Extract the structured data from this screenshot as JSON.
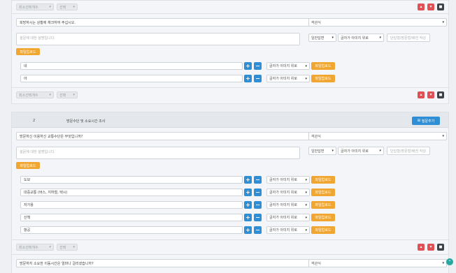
{
  "q1": {
    "top_controls": {
      "min_select": "최소선택개수",
      "max_select": "선택"
    },
    "question_text": "희망하시는 상황에 체크하여 주십시오.",
    "type_select": "객관식",
    "desc_placeholder": "설문에 대한 설명입니다.",
    "answer_type": "일반답변",
    "char_type": "글자가 아미지 위로",
    "unit_placeholder": "단답형/장문형/배전 작성",
    "file_upload": "파일업로드",
    "options": [
      {
        "value": "네",
        "char_type": "글자가 아미지 위로",
        "upload": "파일업로드"
      },
      {
        "value": "아",
        "char_type": "글자가 아미지 위로",
        "upload": "파일업로드"
      }
    ],
    "bottom_controls": {
      "min_select": "최소선택개수",
      "max_select": "선택"
    }
  },
  "section2": {
    "number": "2",
    "title": "방문수단 및 소요시간 조사",
    "add_button": "질문추가",
    "q1": {
      "question_text": "방문하신 이용하신 교통수단은 무엇입니까?",
      "type_select": "객관식",
      "desc_placeholder": "설문에 대한 설명입니다.",
      "answer_type": "일반답변",
      "char_type": "글자가 아미지 위로",
      "unit_placeholder": "단답형/장문형/배전 작성",
      "file_upload": "파일업로드",
      "options": [
        {
          "value": "도보",
          "char_type": "글자가 아미지 위로",
          "upload": "파일업로드"
        },
        {
          "value": "대중교통 (버스, 지하철, 택시)",
          "char_type": "글자가 아미지 위로",
          "upload": "파일업로드"
        },
        {
          "value": "자가용",
          "char_type": "글자가 아미지 위로",
          "upload": "파일업로드"
        },
        {
          "value": "산책",
          "char_type": "글자가 아미지 위로",
          "upload": "파일업로드"
        },
        {
          "value": "항공",
          "char_type": "글자가 아미지 위로",
          "upload": "파일업로드"
        }
      ],
      "bottom_controls": {
        "min_select": "최소선택개수",
        "max_select": "선택"
      }
    },
    "q2": {
      "question_text": "방문하지 소요한 이동시간은 얼마나 걸리셨습니까?",
      "type_select": "객관식"
    }
  }
}
